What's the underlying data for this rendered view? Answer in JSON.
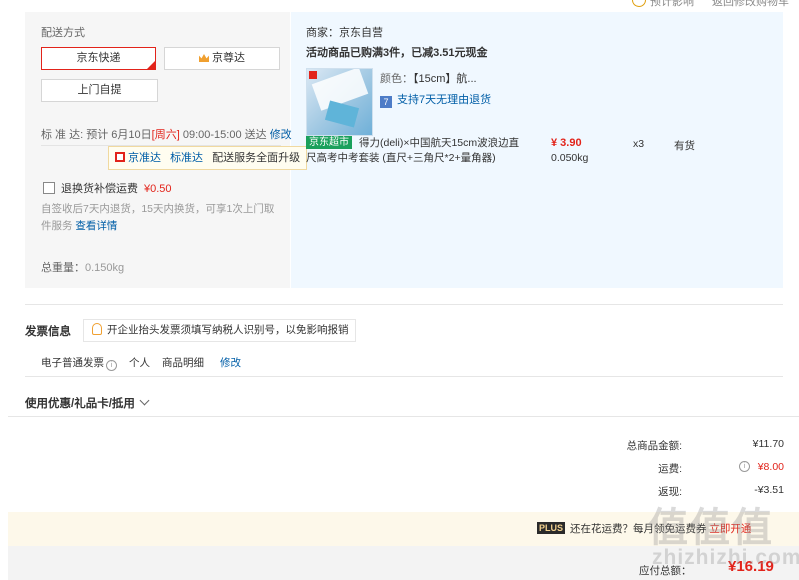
{
  "top": {
    "text_left": "预计影响",
    "text_right": "返回修改购物车"
  },
  "shipping": {
    "title": "配送方式",
    "options": [
      "京东快递",
      "京尊达",
      "上门自提"
    ],
    "date_label": "标 准 达:",
    "date_text": "预计 6月10日",
    "weekday": "[周六]",
    "time_text": "09:00-15:00 送达",
    "modify": "修改",
    "tooltip": {
      "brand1": "京准达",
      "brand2": "标准达",
      "text": "配送服务全面升级"
    },
    "insurance_label": "退换货补偿运费",
    "insurance_fee": "¥0.50",
    "return_note": "自签收后7天内退货，15天内换货，可享1次上门取件服务",
    "return_link": "查看详情",
    "weight_label": "总重量：",
    "weight_value": "0.150kg"
  },
  "products": {
    "seller": "商家：京东自营",
    "promo": "活动商品已购满3件，已减3.51元现金",
    "spec_label": "颜色：",
    "spec_value": "【15cm】航...",
    "return7": "支持7天无理由退货",
    "item": {
      "tag": "京东超市",
      "name": "得力(deli)×中国航天15cm波浪边直尺高考中考套装 (直尺+三角尺*2+量角器)",
      "price": "¥ 3.90",
      "weight": "0.050kg",
      "qty": "x3",
      "stock": "有货"
    }
  },
  "invoice": {
    "title": "发票信息",
    "tip": "开企业抬头发票须填写纳税人识别号，以免影响报销",
    "type": "电子普通发票",
    "person": "个人",
    "detail": "商品明细",
    "modify": "修改"
  },
  "coupon": {
    "label": "使用优惠/礼品卡/抵用"
  },
  "summary": {
    "total_label": "总商品金额:",
    "total_value": "¥11.70",
    "shipping_label": "运费:",
    "shipping_value": "¥8.00",
    "cashback_label": "返现:",
    "cashback_value": "-¥3.51"
  },
  "plus": {
    "badge": "PLUS",
    "text": "还在花运费？每月领",
    "text2": "免运费券",
    "action": "立即开通"
  },
  "payable": {
    "label": "应付总额：",
    "value": "¥16.19"
  },
  "watermark": {
    "main": "值值值",
    "sub": "zhizhizhi.com"
  },
  "colors": {
    "accent": "#e2231a",
    "link": "#005ea7",
    "jd_green": "#1aa05c"
  }
}
